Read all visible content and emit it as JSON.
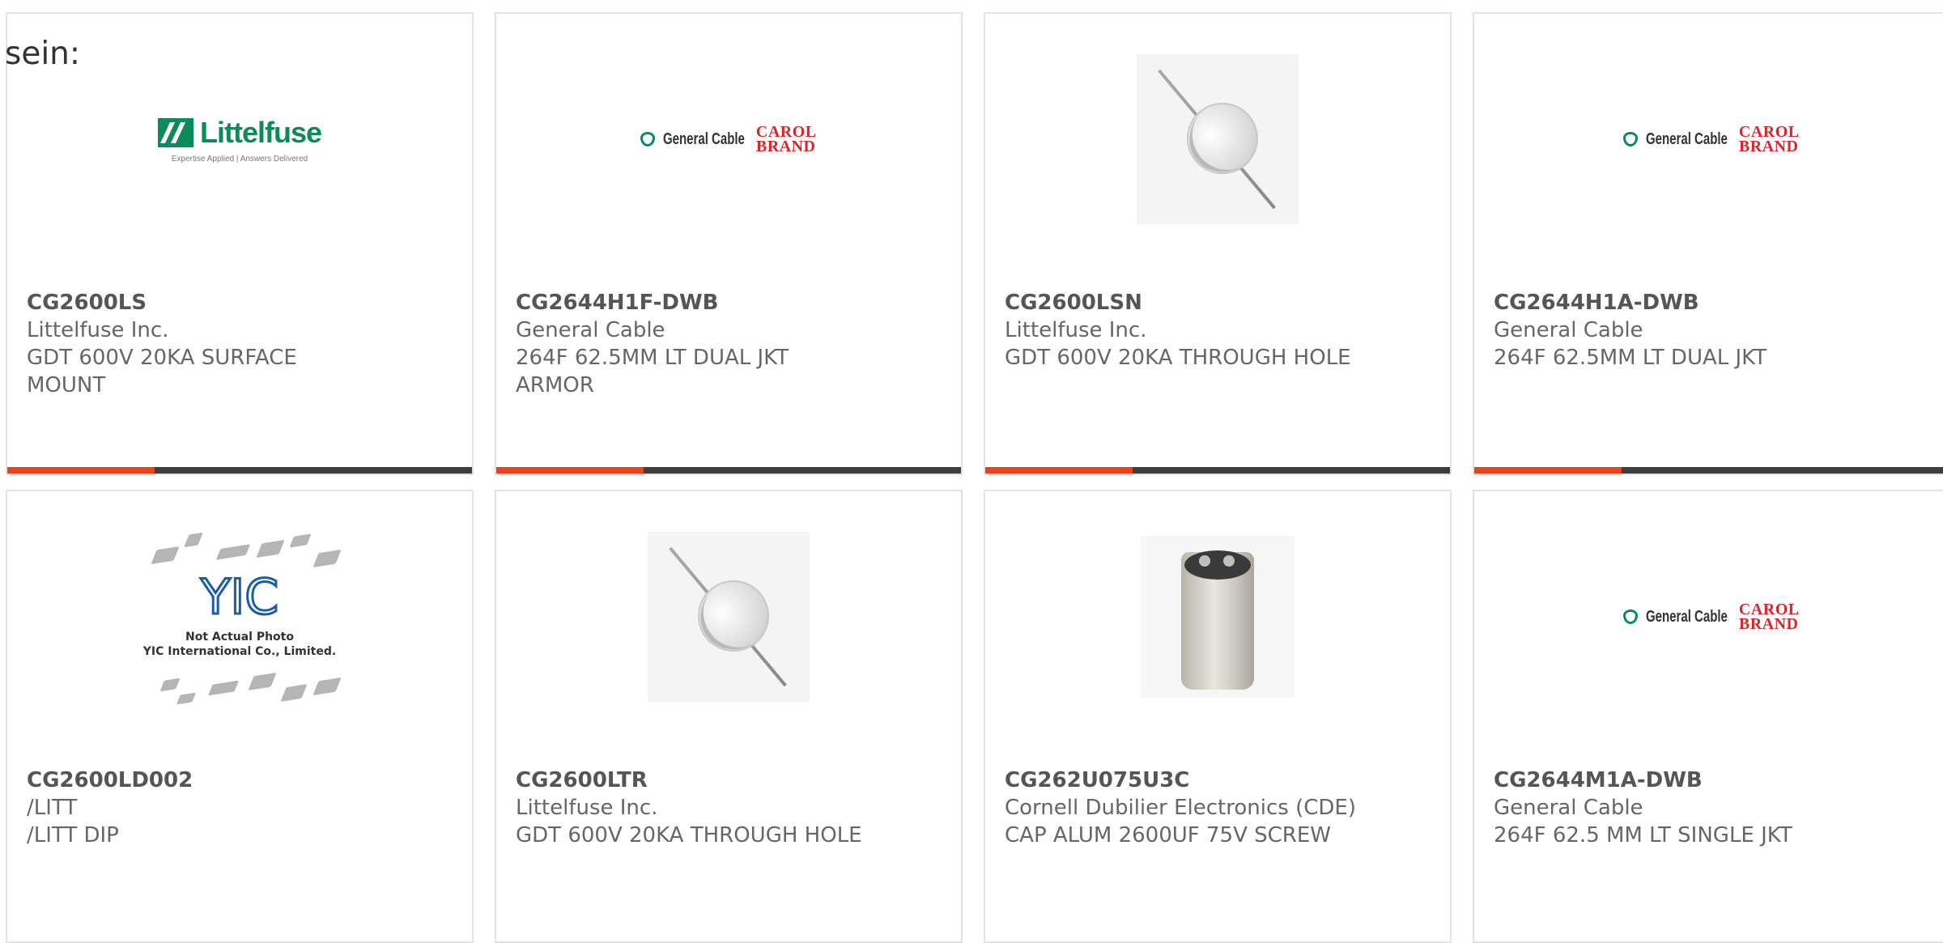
{
  "heading": "sein:",
  "colors": {
    "accent": "#e8421c",
    "bar": "#3d3d3d",
    "border": "#e2e2e2"
  },
  "products": [
    {
      "part": "CG2600LS",
      "mfr": "Littelfuse Inc.",
      "desc": [
        "GDT 600V 20KA SURFACE",
        "MOUNT"
      ],
      "image": "littelfuse-logo"
    },
    {
      "part": "CG2644H1F-DWB",
      "mfr": "General Cable",
      "desc": [
        "264F 62.5MM LT DUAL JKT",
        "ARMOR"
      ],
      "image": "general-cable-logo"
    },
    {
      "part": "CG2600LSN",
      "mfr": "Littelfuse Inc.",
      "desc": [
        "GDT 600V 20KA THROUGH HOLE"
      ],
      "image": "gas-discharge-tube-photo"
    },
    {
      "part": "CG2644H1A-DWB",
      "mfr": "General Cable",
      "desc": [
        "264F 62.5MM LT DUAL JKT"
      ],
      "image": "general-cable-logo"
    },
    {
      "part": "CG2600LD002",
      "mfr": "/LITT",
      "desc": [
        "/LITT DIP"
      ],
      "image": "yic-placeholder"
    },
    {
      "part": "CG2600LTR",
      "mfr": "Littelfuse Inc.",
      "desc": [
        "GDT 600V 20KA THROUGH HOLE"
      ],
      "image": "gas-discharge-tube-photo"
    },
    {
      "part": "CG262U075U3C",
      "mfr": "Cornell Dubilier Electronics (CDE)",
      "desc": [
        "CAP ALUM 2600UF 75V SCREW"
      ],
      "image": "capacitor-photo"
    },
    {
      "part": "CG2644M1A-DWB",
      "mfr": "General Cable",
      "desc": [
        "264F 62.5 MM LT SINGLE JKT"
      ],
      "image": "general-cable-logo"
    }
  ],
  "logos": {
    "littelfuse": {
      "word": "Littelfuse",
      "tagline": "Expertise Applied | Answers Delivered"
    },
    "general_cable": {
      "name": "General Cable",
      "brand_line1": "CAROL",
      "brand_line2": "BRAND"
    },
    "yic": {
      "mark": "YIC",
      "line1": "Not Actual Photo",
      "line2": "YIC International Co., Limited."
    }
  }
}
